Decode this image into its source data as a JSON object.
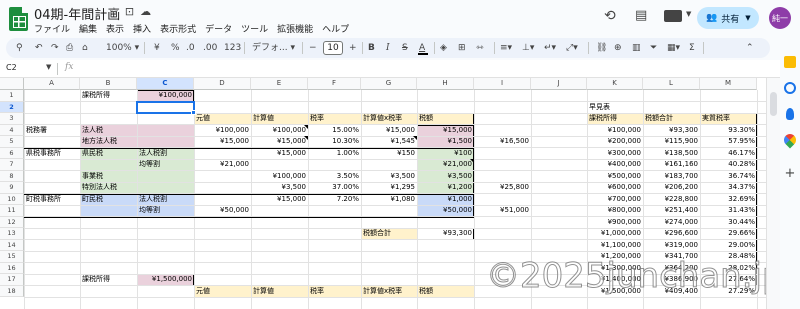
{
  "title": {
    "doc_name": "04期-年間計画"
  },
  "menu": [
    "ファイル",
    "編集",
    "表示",
    "挿入",
    "表示形式",
    "データ",
    "ツール",
    "拡張機能",
    "ヘルプ"
  ],
  "header": {
    "share_label": "共有",
    "avatar_text": "純一"
  },
  "toolbar": {
    "zoom": "100%",
    "font_family": "デフォ...",
    "font_size": "10",
    "percent": "%",
    "currency": "¥",
    "decimal_dec": ".0",
    "decimal_inc": ".00",
    "number_format": "123",
    "minus": "−",
    "plus": "+",
    "bold": "B",
    "italic": "I",
    "strike": "S",
    "text_color": "A"
  },
  "formula_bar": {
    "name_box": "C2",
    "fx": "fx"
  },
  "columns": [
    "A",
    "B",
    "C",
    "D",
    "E",
    "F",
    "G",
    "H",
    "I",
    "J",
    "K",
    "L",
    "M"
  ],
  "rows": [
    "1",
    "2",
    "3",
    "4",
    "5",
    "6",
    "7",
    "8",
    "9",
    "10",
    "11",
    "12",
    "13",
    "14",
    "15",
    "16",
    "17",
    "18"
  ],
  "sheet": {
    "b1": "課税所得",
    "c1": "¥100,000",
    "d3": "元値",
    "e3": "計算値",
    "f3": "税率",
    "g3": "計算値x税率",
    "h3": "税額",
    "a4": "税務署",
    "b4": "法人税",
    "d4": "¥100,000",
    "e4": "¥100,000",
    "f4": "15.00%",
    "g4": "¥15,000",
    "h4": "¥15,000",
    "b5": "地方法人税",
    "d5": "¥15,000",
    "e5": "¥15,000",
    "f5": "10.30%",
    "g5": "¥1,545",
    "h5": "¥1,500",
    "i5": "¥16,500",
    "a6": "県税事務所",
    "b6": "県民税",
    "c6": "法人税割",
    "e6": "¥15,000",
    "f6": "1.00%",
    "g6": "¥150",
    "h6": "¥100",
    "c7": "均等割",
    "d7": "¥21,000",
    "h7": "¥21,000",
    "b8": "事業税",
    "e8": "¥100,000",
    "f8": "3.50%",
    "g8": "¥3,500",
    "h8": "¥3,500",
    "b9": "特別法人税",
    "e9": "¥3,500",
    "f9": "37.00%",
    "g9": "¥1,295",
    "h9": "¥1,200",
    "i9": "¥25,800",
    "a10": "町税事務所",
    "b10": "町民税",
    "c10": "法人税割",
    "e10": "¥15,000",
    "f10": "7.20%",
    "g10": "¥1,080",
    "h10": "¥1,000",
    "c11": "均等割",
    "d11": "¥50,000",
    "h11": "¥50,000",
    "i11": "¥51,000",
    "g13": "税額合計",
    "h13": "¥93,300",
    "b17": "課税所得",
    "c17": "¥1,500,000",
    "d18": "元値",
    "e18": "計算値",
    "f18": "税率",
    "g18": "計算値x税率",
    "h18": "税額"
  },
  "quick_table": {
    "title": "早見表",
    "headers": [
      "課税所得",
      "税額合計",
      "実質税率"
    ],
    "rows": [
      [
        "¥100,000",
        "¥93,300",
        "93.30%"
      ],
      [
        "¥200,000",
        "¥115,900",
        "57.95%"
      ],
      [
        "¥300,000",
        "¥138,500",
        "46.17%"
      ],
      [
        "¥400,000",
        "¥161,160",
        "40.28%"
      ],
      [
        "¥500,000",
        "¥183,700",
        "36.74%"
      ],
      [
        "¥600,000",
        "¥206,200",
        "34.37%"
      ],
      [
        "¥700,000",
        "¥228,800",
        "32.69%"
      ],
      [
        "¥800,000",
        "¥251,400",
        "31.43%"
      ],
      [
        "¥900,000",
        "¥274,000",
        "30.44%"
      ],
      [
        "¥1,000,000",
        "¥296,600",
        "29.66%"
      ],
      [
        "¥1,100,000",
        "¥319,000",
        "29.00%"
      ],
      [
        "¥1,200,000",
        "¥341,700",
        "28.48%"
      ],
      [
        "¥1,300,000",
        "¥364,200",
        "28.02%"
      ],
      [
        "¥1,400,000",
        "¥386,900",
        "27.64%"
      ],
      [
        "¥1,500,000",
        "¥409,400",
        "27.29%"
      ]
    ]
  },
  "watermark": "©2025junchan.jp",
  "colors": {
    "pink": "#ead1dc",
    "green": "#d9ead3",
    "blue": "#c9daf8",
    "yellow": "#fff2cc",
    "accent": "#1a73e8"
  }
}
